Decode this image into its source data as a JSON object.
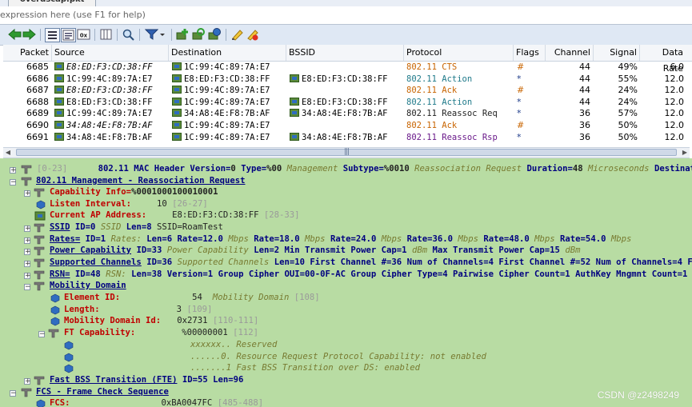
{
  "window": {
    "title_tab": "overdscap.pkt"
  },
  "filter": {
    "placeholder": "expression here (use F1 for help)",
    "value": ""
  },
  "toolbar": {
    "icons": [
      "back-arrow-icon",
      "forward-arrow-icon",
      "list-view-icon",
      "detail-view-icon",
      "hex-view-icon",
      "columns-icon",
      "search-icon",
      "filter-icon",
      "filter-dropdown-icon",
      "add-icon",
      "refresh-icon",
      "save-icon",
      "bookmark-icon",
      "highlight-icon"
    ]
  },
  "packet_list": {
    "columns": [
      "Packet",
      "Source",
      "Destination",
      "BSSID",
      "Protocol",
      "Flags",
      "Channel",
      "Signal",
      "Data Rate"
    ],
    "rows": [
      {
        "packet": "6685",
        "source": "E8:ED:F3:CD:38:FF",
        "source_italic": true,
        "destination": "1C:99:4C:89:7A:E7",
        "bssid": "",
        "protocol": "802.11 CTS",
        "protocol_color": "#c86400",
        "flags": "#",
        "flags_color": "#c86400",
        "channel": "44",
        "signal": "49%",
        "rate": "6.0"
      },
      {
        "packet": "6686",
        "source": "1C:99:4C:89:7A:E7",
        "source_italic": false,
        "destination": "E8:ED:F3:CD:38:FF",
        "bssid": "E8:ED:F3:CD:38:FF",
        "protocol": "802.11 Action",
        "protocol_color": "#1f7a8a",
        "flags": "*",
        "flags_color": "#1f3c8a",
        "channel": "44",
        "signal": "55%",
        "rate": "12.0"
      },
      {
        "packet": "6687",
        "source": "E8:ED:F3:CD:38:FF",
        "source_italic": true,
        "destination": "1C:99:4C:89:7A:E7",
        "bssid": "",
        "protocol": "802.11 Ack",
        "protocol_color": "#c86400",
        "flags": "#",
        "flags_color": "#c86400",
        "channel": "44",
        "signal": "24%",
        "rate": "12.0"
      },
      {
        "packet": "6688",
        "source": "E8:ED:F3:CD:38:FF",
        "source_italic": false,
        "destination": "1C:99:4C:89:7A:E7",
        "bssid": "E8:ED:F3:CD:38:FF",
        "protocol": "802.11 Action",
        "protocol_color": "#1f7a8a",
        "flags": "*",
        "flags_color": "#1f3c8a",
        "channel": "44",
        "signal": "24%",
        "rate": "12.0"
      },
      {
        "packet": "6689",
        "source": "1C:99:4C:89:7A:E7",
        "source_italic": false,
        "destination": "34:A8:4E:F8:7B:AF",
        "bssid": "34:A8:4E:F8:7B:AF",
        "protocol": "802.11 Reassoc Req",
        "protocol_color": "#222222",
        "flags": "*",
        "flags_color": "#1f3c8a",
        "channel": "36",
        "signal": "57%",
        "rate": "12.0"
      },
      {
        "packet": "6690",
        "source": "34:A8:4E:F8:7B:AF",
        "source_italic": true,
        "destination": "1C:99:4C:89:7A:E7",
        "bssid": "",
        "protocol": "802.11 Ack",
        "protocol_color": "#c86400",
        "flags": "#",
        "flags_color": "#c86400",
        "channel": "36",
        "signal": "50%",
        "rate": "12.0"
      },
      {
        "packet": "6691",
        "source": "34:A8:4E:F8:7B:AF",
        "source_italic": false,
        "destination": "1C:99:4C:89:7A:E7",
        "bssid": "34:A8:4E:F8:7B:AF",
        "protocol": "802.11 Reassoc Rsp",
        "protocol_color": "#6a1a8a",
        "flags": "*",
        "flags_color": "#1f3c8a",
        "channel": "36",
        "signal": "50%",
        "rate": "12.0"
      }
    ]
  },
  "details": {
    "mac_header": {
      "range": "[0-23]",
      "text": "802.11 MAC Header",
      "version_label": "Version=",
      "version": "0",
      "type_label": "Type=",
      "type": "%00",
      "type_desc": "Management",
      "subtype_label": "Subtype=",
      "subtype": "%0010",
      "subtype_desc": "Reassociation Request",
      "duration_label": "Duration=",
      "duration": "48",
      "duration_unit": "Microseconds",
      "dest_label": "Destinati"
    },
    "mgmt": "802.11 Management - Reassociation Request",
    "capability": {
      "label": "Capability Info=",
      "value": "%0001000100010001"
    },
    "listen": {
      "label": "Listen Interval:",
      "value": "10",
      "range": "[26-27]"
    },
    "current_ap": {
      "label": "Current AP Address:",
      "value": "E8:ED:F3:CD:38:FF",
      "range": "[28-33]"
    },
    "ssid": {
      "name": "SSID",
      "id": "ID=0",
      "desc": "SSID",
      "len": "Len=8",
      "value": "SSID=RoamTest"
    },
    "rates": {
      "name": "Rates=",
      "id": "ID=1",
      "desc": "Rates:",
      "len": "Len=6",
      "items": [
        [
          "Rate=12.0",
          "Mbps"
        ],
        [
          "Rate=18.0",
          "Mbps"
        ],
        [
          "Rate=24.0",
          "Mbps"
        ],
        [
          "Rate=36.0",
          "Mbps"
        ],
        [
          "Rate=48.0",
          "Mbps"
        ],
        [
          "Rate=54.0",
          "Mbps"
        ]
      ]
    },
    "power": {
      "name": "Power Capability",
      "id": "ID=33",
      "desc": "Power Capability",
      "len": "Len=2",
      "min_label": "Min Transmit Power Cap=1",
      "min_unit": "dBm",
      "max_label": "Max Transmit Power Cap=15",
      "max_unit": "dBm"
    },
    "channels": {
      "name": "Supported Channels",
      "id": "ID=36",
      "desc": "Supported Channels",
      "len": "Len=10",
      "first1": "First Channel #=36",
      "num1": "Num of Channels=4",
      "first2": "First Channel #=52",
      "num2": "Num of Channels=4 F"
    },
    "rsn": {
      "name": "RSN=",
      "id": "ID=48",
      "desc": "RSN:",
      "len": "Len=38",
      "version": "Version=1",
      "gc_oui": "Group Cipher OUI=00-0F-AC",
      "gc_type": "Group Cipher Type=4",
      "pc_count": "Pairwise Cipher Count=1",
      "akm": "AuthKey Mngmnt Count=1"
    },
    "mobility": {
      "name": "Mobility Domain"
    },
    "element_id": {
      "label": "Element ID:",
      "value": "54",
      "desc": "Mobility Domain",
      "range": "[108]"
    },
    "length": {
      "label": "Length:",
      "value": "3",
      "range": "[109]"
    },
    "md_id": {
      "label": "Mobility Domain Id:",
      "value": "0x2731",
      "range": "[110-111]"
    },
    "ft_cap": {
      "label": "FT Capability:",
      "value": "%00000001",
      "range": "[112]"
    },
    "bits": [
      "xxxxxx.. Reserved",
      "......0. Resource Request Protocol Capability: not enabled",
      ".......1 Fast BSS Transition over DS: enabled"
    ],
    "fbt": {
      "name": "Fast BSS Transition (FTE)",
      "id": "ID=55",
      "len": "Len=96"
    },
    "fcs_header": "FCS - Frame Check Sequence",
    "fcs": {
      "label": "FCS:",
      "value": "0xBA0047FC",
      "range": "[485-488]"
    }
  },
  "watermark": "CSDN @z2498249"
}
